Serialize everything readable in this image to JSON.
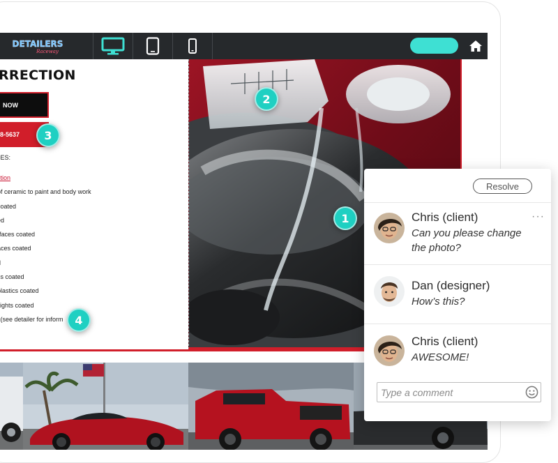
{
  "toolbar": {
    "logo_text": "DETAILERS",
    "logo_sub": "Raceway",
    "devices": [
      {
        "name": "desktop",
        "active": true
      },
      {
        "name": "tablet",
        "active": false
      },
      {
        "name": "mobile",
        "active": false
      }
    ],
    "publish_label": "",
    "accent": "#3ee0d3"
  },
  "page": {
    "heading": "RRECTION",
    "book_label": "NOW",
    "call_label": "8-5637",
    "includes_label": "DES:",
    "services": [
      "ction",
      "of ceramic to paint and body work",
      "coated",
      "ed",
      "rfaces coated",
      "aces coated",
      "d",
      "ss coated",
      "plastics coated",
      "llights coated",
      "l (see detailer for inform"
    ],
    "brand_red": "#d11e2a"
  },
  "markers": [
    "1",
    "2",
    "3",
    "4"
  ],
  "comments_panel": {
    "resolve_label": "Resolve",
    "comments": [
      {
        "author": "Chris (client)",
        "text": "Can you please change the photo?"
      },
      {
        "author": "Dan (designer)",
        "text": "How’s this?"
      },
      {
        "author": "Chris (client)",
        "text": "AWESOME!"
      }
    ],
    "more_label": "···",
    "input_placeholder": "Type a comment"
  }
}
